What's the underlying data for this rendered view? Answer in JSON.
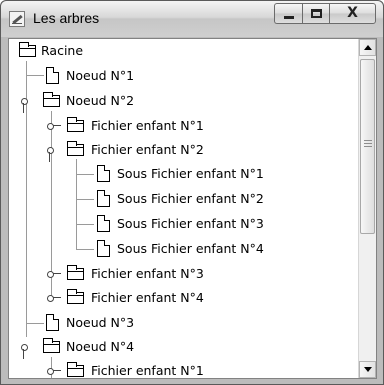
{
  "window": {
    "title": "Les arbres",
    "controls": {
      "minimize": "minimize-icon",
      "maximize": "maximize-icon",
      "close": "close-icon",
      "close_label": "X"
    }
  },
  "tree": {
    "items": [
      {
        "label": "Racine",
        "icon": "folder-icon"
      },
      {
        "label": "Noeud N°1",
        "icon": "file-icon"
      },
      {
        "label": "Noeud N°2",
        "icon": "folder-icon",
        "expanded": true
      },
      {
        "label": "Fichier enfant N°1",
        "icon": "folder-icon",
        "expanded": false
      },
      {
        "label": "Fichier enfant N°2",
        "icon": "folder-icon",
        "expanded": true
      },
      {
        "label": "Sous Fichier enfant N°1",
        "icon": "file-icon"
      },
      {
        "label": "Sous Fichier enfant N°2",
        "icon": "file-icon"
      },
      {
        "label": "Sous Fichier enfant N°3",
        "icon": "file-icon"
      },
      {
        "label": "Sous Fichier enfant N°4",
        "icon": "file-icon"
      },
      {
        "label": "Fichier enfant N°3",
        "icon": "folder-icon",
        "expanded": false
      },
      {
        "label": "Fichier enfant N°4",
        "icon": "folder-icon",
        "expanded": false
      },
      {
        "label": "Noeud N°3",
        "icon": "file-icon"
      },
      {
        "label": "Noeud N°4",
        "icon": "folder-icon",
        "expanded": true
      },
      {
        "label": "Fichier enfant N°1",
        "icon": "folder-icon",
        "expanded": false
      }
    ]
  }
}
